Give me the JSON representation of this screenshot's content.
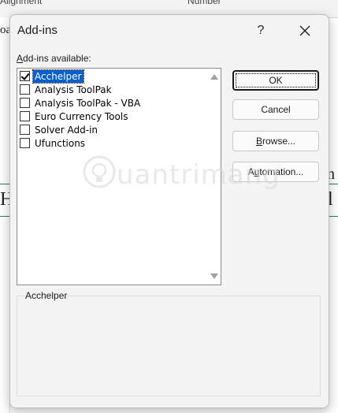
{
  "background": {
    "ribbon_left": "Alignment",
    "ribbon_right": "Number",
    "left_fragment": "oa",
    "right_text_top": "n",
    "left_text_mid": "H",
    "right_text_mid": "l"
  },
  "dialog": {
    "title": "Add-ins",
    "help_glyph": "?",
    "list_label": {
      "accel": "A",
      "rest": "dd-ins available:"
    },
    "items": [
      {
        "label": "Acchelper",
        "checked": true,
        "selected": true
      },
      {
        "label": "Analysis ToolPak",
        "checked": false,
        "selected": false
      },
      {
        "label": "Analysis ToolPak - VBA",
        "checked": false,
        "selected": false
      },
      {
        "label": "Euro Currency Tools",
        "checked": false,
        "selected": false
      },
      {
        "label": "Solver Add-in",
        "checked": false,
        "selected": false
      },
      {
        "label": "Ufunctions",
        "checked": false,
        "selected": false
      }
    ],
    "buttons": {
      "ok": "OK",
      "cancel": "Cancel",
      "browse": {
        "accel": "B",
        "rest": "rowse..."
      },
      "automation": {
        "before": "A",
        "accel": "u",
        "rest": "tomation..."
      }
    },
    "description_title": "Acchelper"
  },
  "watermark": {
    "text": "uantrimang"
  },
  "colors": {
    "selection": "#0a5fd0",
    "dialog_bg": "#f3f3f3",
    "sheet_line": "#2e7d4f"
  }
}
